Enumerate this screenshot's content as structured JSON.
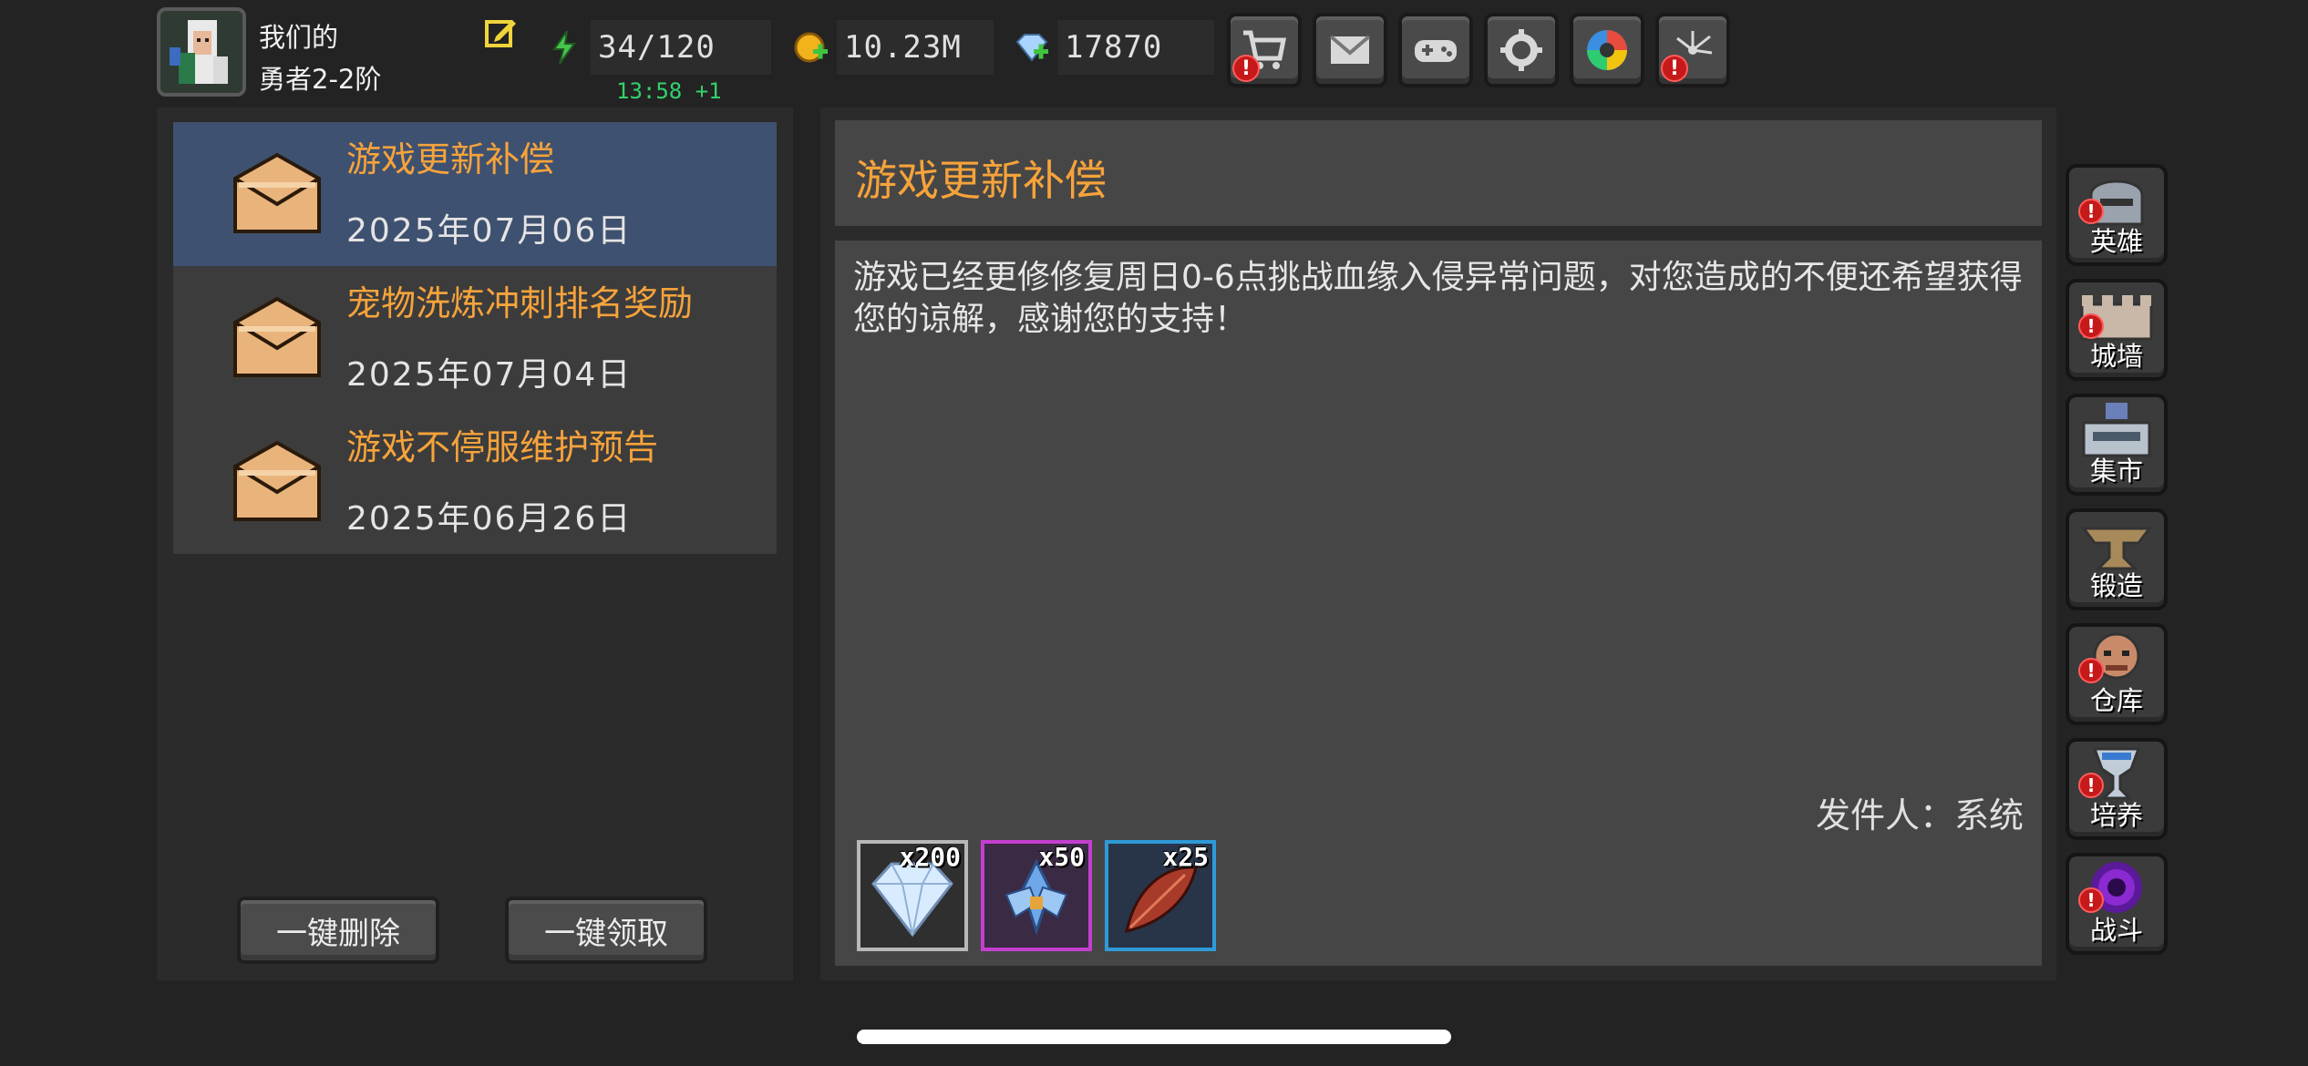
{
  "player": {
    "name": "我们的",
    "rank": "勇者2-2阶"
  },
  "resources": {
    "stamina": {
      "value": "34/120",
      "timer": "13:58 +1"
    },
    "gold": {
      "value": "10.23M"
    },
    "gems": {
      "value": "17870"
    }
  },
  "mail_list": [
    {
      "title": "游戏更新补偿",
      "date": "2025年07月06日",
      "selected": true
    },
    {
      "title": "宠物洗炼冲刺排名奖励",
      "date": "2025年07月04日",
      "selected": false
    },
    {
      "title": "游戏不停服维护预告",
      "date": "2025年06月26日",
      "selected": false
    }
  ],
  "actions": {
    "delete_all": "一键删除",
    "claim_all": "一键领取"
  },
  "detail": {
    "title": "游戏更新补偿",
    "content": "游戏已经更修修复周日0-6点挑战血缘入侵异常问题，对您造成的不便还希望获得您的谅解，感谢您的支持！",
    "sender": "发件人：系统",
    "attachments": [
      {
        "item": "diamond",
        "qty": "x200",
        "border": "#b8b8b8"
      },
      {
        "item": "blue-crystal",
        "qty": "x50",
        "border": "#c43fcf"
      },
      {
        "item": "red-feather",
        "qty": "x25",
        "border": "#2f9ad8"
      }
    ]
  },
  "side_nav": [
    {
      "label": "英雄",
      "icon": "helmet-icon",
      "alert": true
    },
    {
      "label": "城墙",
      "icon": "wall-icon",
      "alert": true
    },
    {
      "label": "集市",
      "icon": "market-icon",
      "alert": false
    },
    {
      "label": "锻造",
      "icon": "anvil-icon",
      "alert": false
    },
    {
      "label": "仓库",
      "icon": "warehouse-icon",
      "alert": true
    },
    {
      "label": "培养",
      "icon": "chalice-icon",
      "alert": true
    },
    {
      "label": "战斗",
      "icon": "portal-icon",
      "alert": true
    }
  ],
  "toolbar": [
    {
      "icon": "cart-icon",
      "alert": true
    },
    {
      "icon": "mail-icon",
      "alert": false
    },
    {
      "icon": "gamepad-icon",
      "alert": false
    },
    {
      "icon": "gear-icon",
      "alert": false
    },
    {
      "icon": "color-wheel-icon",
      "alert": false
    },
    {
      "icon": "fireworks-icon",
      "alert": true
    }
  ],
  "alert_glyph": "!",
  "colors": {
    "accent": "#f6a33b",
    "selected": "#3f5170",
    "timer": "#33d16a",
    "alert": "#c61a1a"
  }
}
